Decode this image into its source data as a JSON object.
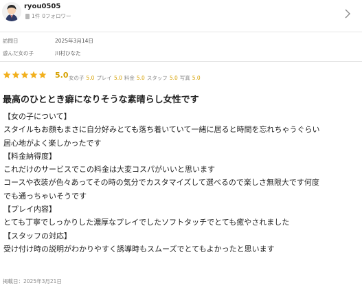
{
  "user": {
    "name": "ryou0505",
    "posts": "1件",
    "followers": "0フォロワー"
  },
  "info": {
    "visit_label": "訪問日",
    "visit_value": "2025年3月14日",
    "girl_label": "遊んだ女の子",
    "girl_value": "川村ひなた"
  },
  "rating": {
    "stars": 5,
    "overall": "5.0",
    "items": [
      {
        "label": "女の子",
        "value": "5.0"
      },
      {
        "label": "プレイ",
        "value": "5.0"
      },
      {
        "label": "料金",
        "value": "5.0"
      },
      {
        "label": "スタッフ",
        "value": "5.0"
      },
      {
        "label": "写真",
        "value": "5.0"
      }
    ]
  },
  "review": {
    "title": "最高のひととき癖になりそうな素晴らし女性です",
    "lines": [
      "【女の子について】",
      "スタイルもお顔もまさに自分好みとても落ち着いていて一緒に居ると時間を忘れちゃうぐらい",
      "居心地がよく楽しかったです",
      "【料金納得度】",
      "これだけのサービスでこの料金は大変コスパがいいと思います",
      "コースや衣装が色々あってその時の気分でカスタマイズして選べるので楽しさ無限大です何度",
      "でも通っちゃいそうです",
      "【プレイ内容】",
      "とても丁寧でしっかりした濃厚なプレイでしたソフトタッチでとても癒やされました",
      "【スタッフの対応】",
      "受け付け時の説明がわかりやすく誘導時もスムーズでとてもよかったと思います"
    ],
    "posted": "掲載日：2025年3月21日"
  },
  "colors": {
    "star": "#f2b01e",
    "score": "#d6a100"
  },
  "icons": [
    "avatar-icon",
    "document-icon",
    "chevron-right-icon",
    "star-icon"
  ]
}
